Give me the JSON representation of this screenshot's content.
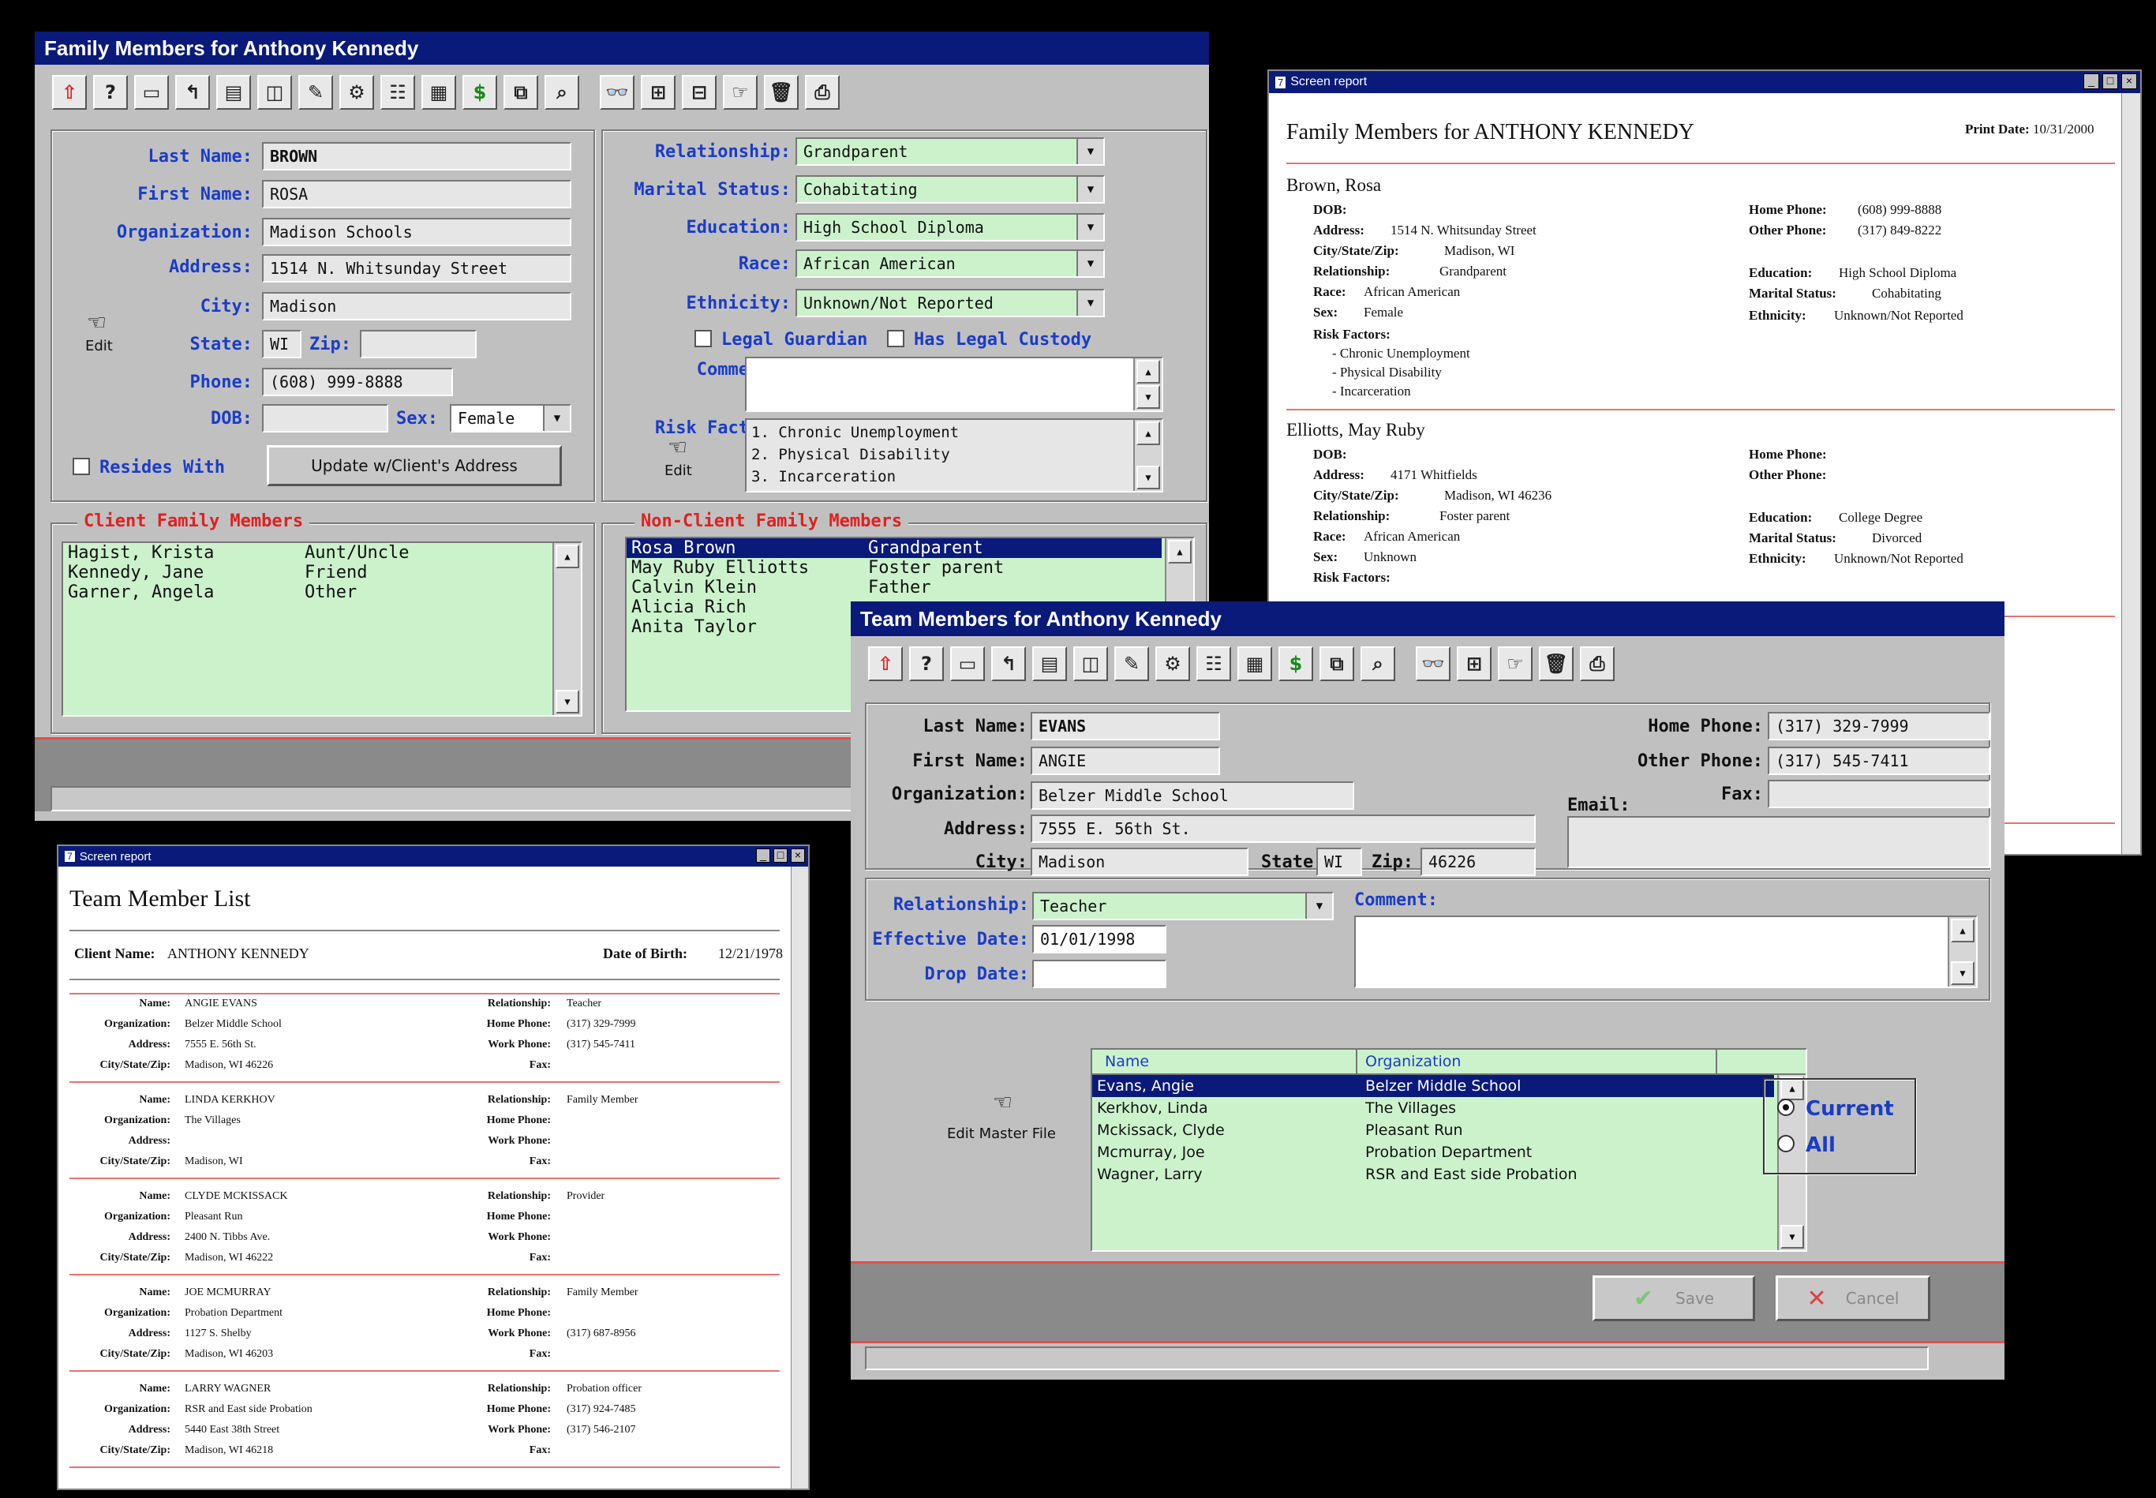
{
  "family": {
    "title": "Family Members for Anthony Kennedy",
    "toolbar": [
      "⇧",
      "?",
      "▭",
      "↰",
      "▤",
      "◫",
      "✎",
      "⚙",
      "☷",
      "▦",
      "$",
      "⧉",
      "⌕",
      "👓",
      "⊞",
      "⊟",
      "☞",
      "🗑",
      "⎙"
    ],
    "labels": {
      "last": "Last Name:",
      "first": "First Name:",
      "org": "Organization:",
      "address": "Address:",
      "city": "City:",
      "state": "State:",
      "zip": "Zip:",
      "phone": "Phone:",
      "dob": "DOB:",
      "sex": "Sex:",
      "resides": "Resides With",
      "update": "Update w/Client's Address",
      "edit": "Edit",
      "relationship": "Relationship:",
      "marital": "Marital Status:",
      "education": "Education:",
      "race": "Race:",
      "ethnicity": "Ethnicity:",
      "guardian": "Legal Guardian",
      "custody": "Has Legal Custody",
      "comments": "Comments:",
      "risk": "Risk Factors:",
      "risk_edit": "Edit",
      "client_group": "Client Family Members",
      "nonclient_group": "Non-Client Family Members"
    },
    "values": {
      "last": "BROWN",
      "first": "ROSA",
      "org": "Madison Schools",
      "address": "1514 N. Whitsunday Street",
      "city": "Madison",
      "state": "WI",
      "zip": "",
      "phone": "(608) 999-8888",
      "dob": "",
      "sex": "Female",
      "relationship": "Grandparent",
      "marital": "Cohabitating",
      "education": "High School Diploma",
      "race": "African American",
      "ethnicity": "Unknown/Not Reported"
    },
    "risk_factors": [
      "1. Chronic Unemployment",
      "2. Physical Disability",
      "3. Incarceration"
    ],
    "client_members": [
      {
        "name": "Hagist, Krista",
        "rel": "Aunt/Uncle"
      },
      {
        "name": "Kennedy, Jane",
        "rel": "Friend"
      },
      {
        "name": "Garner, Angela",
        "rel": "Other"
      }
    ],
    "nonclient_members": [
      {
        "name": "Rosa Brown",
        "rel": "Grandparent"
      },
      {
        "name": "May Ruby Elliotts",
        "rel": "Foster parent"
      },
      {
        "name": "Calvin Klein",
        "rel": "Father"
      },
      {
        "name": "Alicia Rich",
        "rel": ""
      },
      {
        "name": "Anita Taylor",
        "rel": ""
      }
    ]
  },
  "report1": {
    "title": "Screen report",
    "heading": "Family Members for ANTHONY KENNEDY",
    "print_label": "Print Date:",
    "print_date": "10/31/2000",
    "p1": {
      "name": "Brown, Rosa",
      "dob": "DOB:",
      "address_l": "Address:",
      "address": "1514 N. Whitsunday Street",
      "csz_l": "City/State/Zip:",
      "csz": "Madison, WI",
      "rel_l": "Relationship:",
      "rel": "Grandparent",
      "race_l": "Race:",
      "race": "African American",
      "sex_l": "Sex:",
      "sex": "Female",
      "risk_l": "Risk Factors:",
      "risks": [
        "- Chronic Unemployment",
        "- Physical Disability",
        "- Incarceration"
      ],
      "hp_l": "Home Phone:",
      "hp": "(608) 999-8888",
      "op_l": "Other Phone:",
      "op": "(317) 849-8222",
      "edu_l": "Education:",
      "edu": "High School Diploma",
      "mar_l": "Marital Status:",
      "mar": "Cohabitating",
      "eth_l": "Ethnicity:",
      "eth": "Unknown/Not Reported"
    },
    "p2": {
      "name": "Elliotts, May Ruby",
      "dob": "DOB:",
      "address_l": "Address:",
      "address": "4171 Whitfields",
      "csz_l": "City/State/Zip:",
      "csz": "Madison, WI  46236",
      "rel_l": "Relationship:",
      "rel": "Foster parent",
      "race_l": "Race:",
      "race": "African American",
      "sex_l": "Sex:",
      "sex": "Unknown",
      "risk_l": "Risk Factors:",
      "hp_l": "Home Phone:",
      "op_l": "Other Phone:",
      "edu_l": "Education:",
      "edu": "College Degree",
      "mar_l": "Marital Status:",
      "mar": "Divorced",
      "eth_l": "Ethnicity:",
      "eth": "Unknown/Not Reported"
    }
  },
  "report2": {
    "title": "Screen report",
    "heading": "Team Member List",
    "client_l": "Client Name:",
    "client": "ANTHONY KENNEDY",
    "dob_l": "Date of Birth:",
    "dob": "12/21/1978",
    "lbl": {
      "name": "Name:",
      "org": "Organization:",
      "address": "Address:",
      "csz": "City/State/Zip:",
      "rel": "Relationship:",
      "hp": "Home Phone:",
      "wp": "Work Phone:",
      "fax": "Fax:"
    },
    "members": [
      {
        "name": "ANGIE EVANS",
        "org": "Belzer Middle School",
        "address": "7555 E. 56th St.",
        "csz": "Madison, WI 46226",
        "rel": "Teacher",
        "hp": "(317) 329-7999",
        "wp": "(317) 545-7411"
      },
      {
        "name": "LINDA KERKHOV",
        "org": "The Villages",
        "address": "",
        "csz": "Madison, WI",
        "rel": "Family Member",
        "hp": "",
        "wp": ""
      },
      {
        "name": "CLYDE MCKISSACK",
        "org": "Pleasant Run",
        "address": "2400 N. Tibbs Ave.",
        "csz": "Madison, WI 46222",
        "rel": "Provider",
        "hp": "",
        "wp": ""
      },
      {
        "name": "JOE MCMURRAY",
        "org": "Probation Department",
        "address": "1127 S. Shelby",
        "csz": "Madison, WI 46203",
        "rel": "Family Member",
        "hp": "",
        "wp": "(317) 687-8956"
      },
      {
        "name": "LARRY WAGNER",
        "org": "RSR and East side Probation",
        "address": "5440 East 38th Street",
        "csz": "Madison, WI 46218",
        "rel": "Probation officer",
        "hp": "(317) 924-7485",
        "wp": "(317) 546-2107"
      }
    ]
  },
  "team": {
    "title": "Team Members for Anthony Kennedy",
    "toolbar": [
      "⇧",
      "?",
      "▭",
      "↰",
      "▤",
      "◫",
      "✎",
      "⚙",
      "☷",
      "▦",
      "$",
      "⧉",
      "⌕",
      "👓",
      "⊞",
      "☞",
      "🗑",
      "⎙"
    ],
    "labels": {
      "last": "Last Name:",
      "first": "First Name:",
      "org": "Organization:",
      "address": "Address:",
      "city": "City:",
      "state": "State:",
      "zip": "Zip:",
      "home": "Home Phone:",
      "other": "Other Phone:",
      "fax": "Fax:",
      "email": "Email:",
      "relationship": "Relationship:",
      "effective": "Effective Date:",
      "drop": "Drop Date:",
      "comment": "Comment:",
      "edit_master": "Edit Master File",
      "col_name": "Name",
      "col_org": "Organization",
      "current": "Current",
      "all": "All",
      "save": "Save",
      "cancel": "Cancel"
    },
    "values": {
      "last": "EVANS",
      "first": "ANGIE",
      "org": "Belzer Middle School",
      "address": "7555 E. 56th St.",
      "city": "Madison",
      "state": "WI",
      "zip": "46226",
      "home": "(317) 329-7999",
      "other": "(317) 545-7411",
      "fax": "",
      "email": "",
      "relationship": "Teacher",
      "effective": "01/01/1998",
      "drop": ""
    },
    "rows": [
      {
        "name": "Evans, Angie",
        "org": "Belzer Middle School"
      },
      {
        "name": "Kerkhov, Linda",
        "org": "The Villages"
      },
      {
        "name": "Mckissack, Clyde",
        "org": "Pleasant Run"
      },
      {
        "name": "Mcmurray, Joe",
        "org": "Probation Department"
      },
      {
        "name": "Wagner, Larry",
        "org": "RSR and East side Probation"
      }
    ]
  }
}
